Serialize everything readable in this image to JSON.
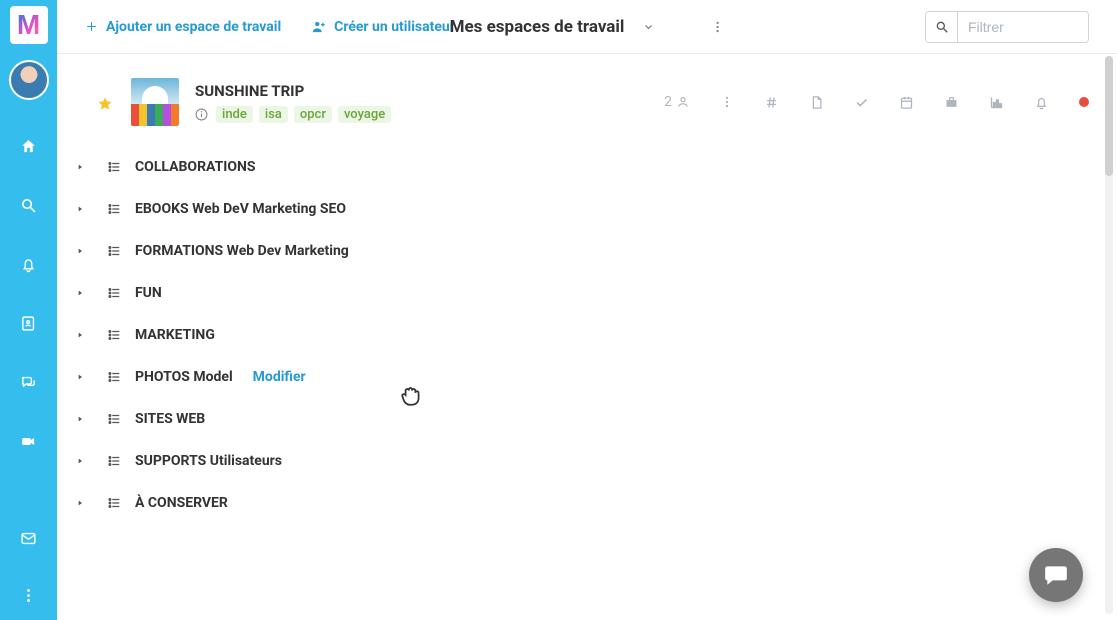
{
  "topbar": {
    "add_workspace_label": "Ajouter un espace de travail",
    "create_user_label": "Créer un utilisateur",
    "center_title": "Mes espaces de travail",
    "filter_placeholder": "Filtrer"
  },
  "workspace": {
    "title": "SUNSHINE TRIP",
    "tags": [
      "inde",
      "isa",
      "opcr",
      "voyage"
    ],
    "user_count": "2"
  },
  "tree": {
    "items": [
      {
        "label": "COLLABORATIONS"
      },
      {
        "label": "EBOOKS Web DeV Marketing SEO"
      },
      {
        "label": "FORMATIONS Web Dev Marketing"
      },
      {
        "label": "FUN"
      },
      {
        "label": "MARKETING"
      },
      {
        "label": "PHOTOS Model"
      },
      {
        "label": "SITES WEB"
      },
      {
        "label": "SUPPORTS Utilisateurs"
      },
      {
        "label": "À CONSERVER"
      }
    ],
    "modify_label": "Modifier"
  },
  "sidebar_icons": [
    "home",
    "search",
    "bell",
    "contacts",
    "chat",
    "video",
    "mail",
    "more"
  ]
}
